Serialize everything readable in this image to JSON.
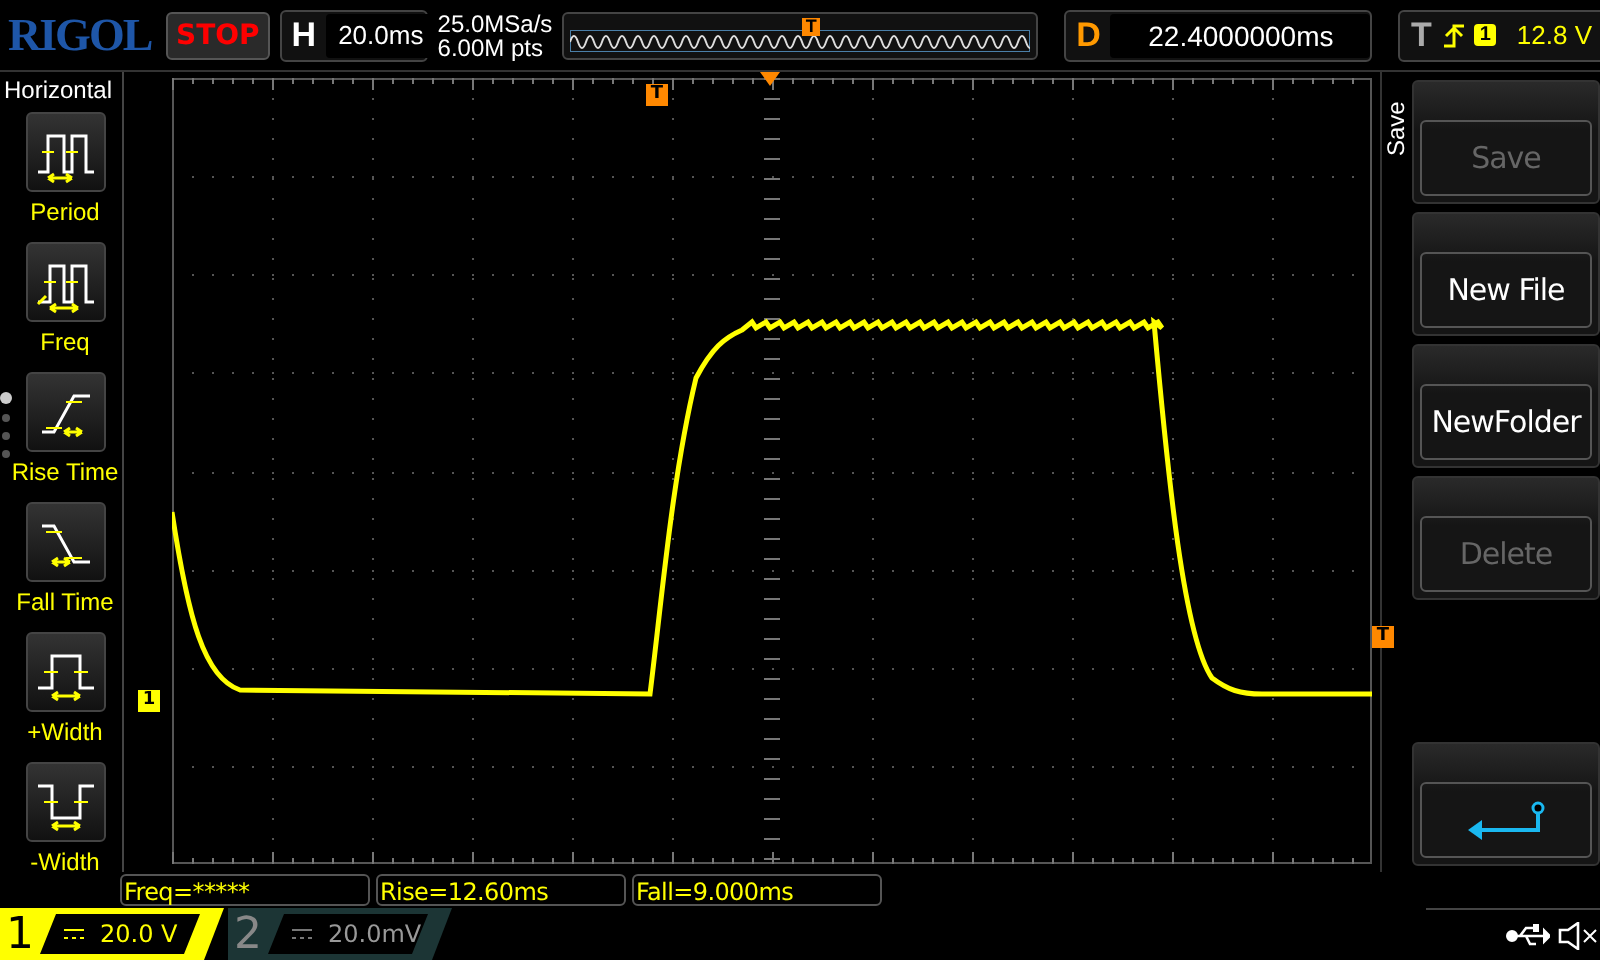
{
  "top_bar": {
    "logo": "RIGOL",
    "run_state": "STOP",
    "horizontal": {
      "label": "H",
      "timebase": "20.0ms"
    },
    "acquisition": {
      "sample_rate": "25.0MSa/s",
      "memory_depth": "6.00M pts"
    },
    "position_marker": "T",
    "delay": {
      "label": "D",
      "value": "22.4000000ms"
    },
    "trigger": {
      "label": "T",
      "source": "1",
      "level": "12.8 V"
    }
  },
  "measure_menu": {
    "title": "Horizontal",
    "items": [
      {
        "kind": "period",
        "label": "Period"
      },
      {
        "kind": "freq",
        "label": "Freq"
      },
      {
        "kind": "rise",
        "label": "Rise Time"
      },
      {
        "kind": "fall",
        "label": "Fall Time"
      },
      {
        "kind": "pwidth",
        "label": "+Width"
      },
      {
        "kind": "nwidth",
        "label": "-Width"
      }
    ],
    "pages": [
      {
        "selected": true
      },
      {
        "selected": false
      },
      {
        "selected": false
      },
      {
        "selected": false
      }
    ]
  },
  "waveform": {
    "channel_marker": "1",
    "trigger_level_marker": "T",
    "trigger_time_marker": "T"
  },
  "measurements": [
    "Freq=*****",
    "Rise=12.60ms",
    "Fall=9.000ms"
  ],
  "channels": [
    {
      "number": "1",
      "scale": "20.0 V",
      "on": true
    },
    {
      "number": "2",
      "scale": "20.0mV",
      "on": false
    }
  ],
  "save_menu": {
    "title": "Save",
    "buttons": [
      {
        "kind": "text",
        "label": "Save",
        "disabled": true
      },
      {
        "kind": "text",
        "label": "New File",
        "disabled": false
      },
      {
        "kind": "text",
        "label": "NewFolder",
        "disabled": false
      },
      {
        "kind": "text",
        "label": "Delete",
        "disabled": true
      },
      {
        "kind": "back"
      }
    ]
  }
}
